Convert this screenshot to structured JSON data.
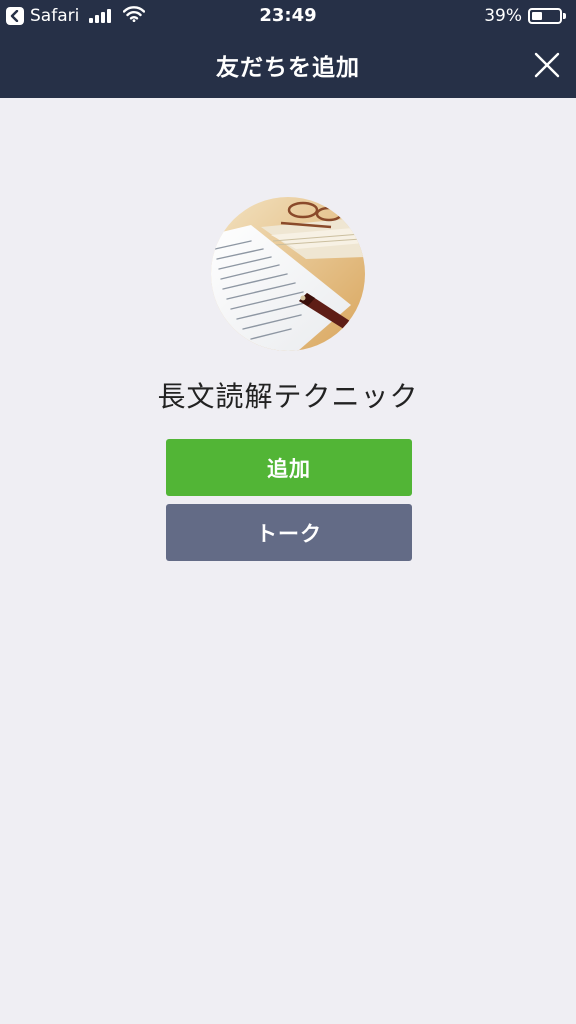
{
  "status_bar": {
    "back_app": "Safari",
    "time": "23:49",
    "battery_percent": "39%",
    "battery_level": 0.39,
    "signal_icon": "cellular-signal-icon",
    "wifi_icon": "wifi-icon"
  },
  "nav": {
    "title": "友だちを追加",
    "close_icon": "close-icon"
  },
  "profile": {
    "name": "長文読解テクニック",
    "photo": "profile-photo"
  },
  "actions": {
    "add_label": "追加",
    "talk_label": "トーク"
  },
  "colors": {
    "header_bg": "#263047",
    "page_bg": "#efeef3",
    "add_button": "#52b536",
    "talk_button": "#636b86"
  }
}
